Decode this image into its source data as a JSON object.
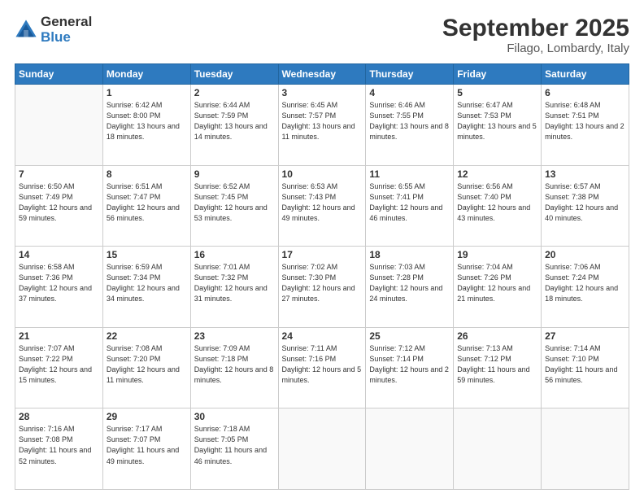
{
  "logo": {
    "general": "General",
    "blue": "Blue"
  },
  "title": "September 2025",
  "subtitle": "Filago, Lombardy, Italy",
  "days_header": [
    "Sunday",
    "Monday",
    "Tuesday",
    "Wednesday",
    "Thursday",
    "Friday",
    "Saturday"
  ],
  "weeks": [
    [
      {
        "num": "",
        "sunrise": "",
        "sunset": "",
        "daylight": ""
      },
      {
        "num": "1",
        "sunrise": "Sunrise: 6:42 AM",
        "sunset": "Sunset: 8:00 PM",
        "daylight": "Daylight: 13 hours and 18 minutes."
      },
      {
        "num": "2",
        "sunrise": "Sunrise: 6:44 AM",
        "sunset": "Sunset: 7:59 PM",
        "daylight": "Daylight: 13 hours and 14 minutes."
      },
      {
        "num": "3",
        "sunrise": "Sunrise: 6:45 AM",
        "sunset": "Sunset: 7:57 PM",
        "daylight": "Daylight: 13 hours and 11 minutes."
      },
      {
        "num": "4",
        "sunrise": "Sunrise: 6:46 AM",
        "sunset": "Sunset: 7:55 PM",
        "daylight": "Daylight: 13 hours and 8 minutes."
      },
      {
        "num": "5",
        "sunrise": "Sunrise: 6:47 AM",
        "sunset": "Sunset: 7:53 PM",
        "daylight": "Daylight: 13 hours and 5 minutes."
      },
      {
        "num": "6",
        "sunrise": "Sunrise: 6:48 AM",
        "sunset": "Sunset: 7:51 PM",
        "daylight": "Daylight: 13 hours and 2 minutes."
      }
    ],
    [
      {
        "num": "7",
        "sunrise": "Sunrise: 6:50 AM",
        "sunset": "Sunset: 7:49 PM",
        "daylight": "Daylight: 12 hours and 59 minutes."
      },
      {
        "num": "8",
        "sunrise": "Sunrise: 6:51 AM",
        "sunset": "Sunset: 7:47 PM",
        "daylight": "Daylight: 12 hours and 56 minutes."
      },
      {
        "num": "9",
        "sunrise": "Sunrise: 6:52 AM",
        "sunset": "Sunset: 7:45 PM",
        "daylight": "Daylight: 12 hours and 53 minutes."
      },
      {
        "num": "10",
        "sunrise": "Sunrise: 6:53 AM",
        "sunset": "Sunset: 7:43 PM",
        "daylight": "Daylight: 12 hours and 49 minutes."
      },
      {
        "num": "11",
        "sunrise": "Sunrise: 6:55 AM",
        "sunset": "Sunset: 7:41 PM",
        "daylight": "Daylight: 12 hours and 46 minutes."
      },
      {
        "num": "12",
        "sunrise": "Sunrise: 6:56 AM",
        "sunset": "Sunset: 7:40 PM",
        "daylight": "Daylight: 12 hours and 43 minutes."
      },
      {
        "num": "13",
        "sunrise": "Sunrise: 6:57 AM",
        "sunset": "Sunset: 7:38 PM",
        "daylight": "Daylight: 12 hours and 40 minutes."
      }
    ],
    [
      {
        "num": "14",
        "sunrise": "Sunrise: 6:58 AM",
        "sunset": "Sunset: 7:36 PM",
        "daylight": "Daylight: 12 hours and 37 minutes."
      },
      {
        "num": "15",
        "sunrise": "Sunrise: 6:59 AM",
        "sunset": "Sunset: 7:34 PM",
        "daylight": "Daylight: 12 hours and 34 minutes."
      },
      {
        "num": "16",
        "sunrise": "Sunrise: 7:01 AM",
        "sunset": "Sunset: 7:32 PM",
        "daylight": "Daylight: 12 hours and 31 minutes."
      },
      {
        "num": "17",
        "sunrise": "Sunrise: 7:02 AM",
        "sunset": "Sunset: 7:30 PM",
        "daylight": "Daylight: 12 hours and 27 minutes."
      },
      {
        "num": "18",
        "sunrise": "Sunrise: 7:03 AM",
        "sunset": "Sunset: 7:28 PM",
        "daylight": "Daylight: 12 hours and 24 minutes."
      },
      {
        "num": "19",
        "sunrise": "Sunrise: 7:04 AM",
        "sunset": "Sunset: 7:26 PM",
        "daylight": "Daylight: 12 hours and 21 minutes."
      },
      {
        "num": "20",
        "sunrise": "Sunrise: 7:06 AM",
        "sunset": "Sunset: 7:24 PM",
        "daylight": "Daylight: 12 hours and 18 minutes."
      }
    ],
    [
      {
        "num": "21",
        "sunrise": "Sunrise: 7:07 AM",
        "sunset": "Sunset: 7:22 PM",
        "daylight": "Daylight: 12 hours and 15 minutes."
      },
      {
        "num": "22",
        "sunrise": "Sunrise: 7:08 AM",
        "sunset": "Sunset: 7:20 PM",
        "daylight": "Daylight: 12 hours and 11 minutes."
      },
      {
        "num": "23",
        "sunrise": "Sunrise: 7:09 AM",
        "sunset": "Sunset: 7:18 PM",
        "daylight": "Daylight: 12 hours and 8 minutes."
      },
      {
        "num": "24",
        "sunrise": "Sunrise: 7:11 AM",
        "sunset": "Sunset: 7:16 PM",
        "daylight": "Daylight: 12 hours and 5 minutes."
      },
      {
        "num": "25",
        "sunrise": "Sunrise: 7:12 AM",
        "sunset": "Sunset: 7:14 PM",
        "daylight": "Daylight: 12 hours and 2 minutes."
      },
      {
        "num": "26",
        "sunrise": "Sunrise: 7:13 AM",
        "sunset": "Sunset: 7:12 PM",
        "daylight": "Daylight: 11 hours and 59 minutes."
      },
      {
        "num": "27",
        "sunrise": "Sunrise: 7:14 AM",
        "sunset": "Sunset: 7:10 PM",
        "daylight": "Daylight: 11 hours and 56 minutes."
      }
    ],
    [
      {
        "num": "28",
        "sunrise": "Sunrise: 7:16 AM",
        "sunset": "Sunset: 7:08 PM",
        "daylight": "Daylight: 11 hours and 52 minutes."
      },
      {
        "num": "29",
        "sunrise": "Sunrise: 7:17 AM",
        "sunset": "Sunset: 7:07 PM",
        "daylight": "Daylight: 11 hours and 49 minutes."
      },
      {
        "num": "30",
        "sunrise": "Sunrise: 7:18 AM",
        "sunset": "Sunset: 7:05 PM",
        "daylight": "Daylight: 11 hours and 46 minutes."
      },
      {
        "num": "",
        "sunrise": "",
        "sunset": "",
        "daylight": ""
      },
      {
        "num": "",
        "sunrise": "",
        "sunset": "",
        "daylight": ""
      },
      {
        "num": "",
        "sunrise": "",
        "sunset": "",
        "daylight": ""
      },
      {
        "num": "",
        "sunrise": "",
        "sunset": "",
        "daylight": ""
      }
    ]
  ]
}
